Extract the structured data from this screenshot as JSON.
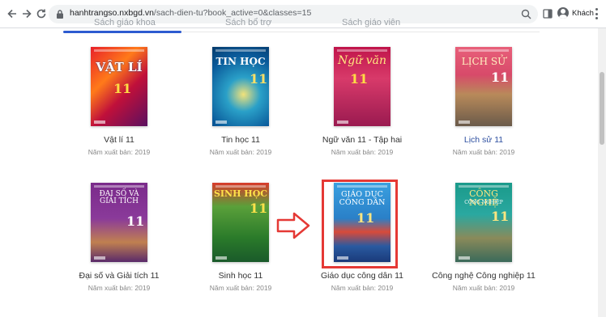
{
  "browser": {
    "url_host": "hanhtrangso.nxbgd.vn",
    "url_path": "/sach-dien-tu?book_active=0&classes=15",
    "profile_label": "Khách"
  },
  "tabs": [
    {
      "label": "Sách giáo khoa",
      "active": true
    },
    {
      "label": "Sách bổ trợ",
      "active": false
    },
    {
      "label": "Sách giáo viên",
      "active": false
    }
  ],
  "books": [
    {
      "title": "Vật lí 11",
      "meta": "Năm xuất bản: 2019",
      "cover_text": "VẬT LÍ",
      "cover_num": "11"
    },
    {
      "title": "Tin học 11",
      "meta": "Năm xuất bản: 2019",
      "cover_text": "TIN HỌC",
      "cover_num": "11"
    },
    {
      "title": "Ngữ văn 11 - Tập hai",
      "meta": "Năm xuất bản: 2019",
      "cover_text": "Ngữ văn",
      "cover_num": "11"
    },
    {
      "title": "Lịch sử 11",
      "meta": "Năm xuất bản: 2019",
      "cover_text": "LỊCH SỬ",
      "cover_num": "11"
    },
    {
      "title": "Đại số và Giải tích 11",
      "meta": "Năm xuất bản: 2019",
      "cover_text": "ĐẠI SỐ VÀ GIẢI TÍCH",
      "cover_num": "11"
    },
    {
      "title": "Sinh học 11",
      "meta": "Năm xuất bản: 2019",
      "cover_text": "SINH HỌC",
      "cover_num": "11"
    },
    {
      "title": "Giáo dục công dân 11",
      "meta": "Năm xuất bản: 2019",
      "cover_text": "GIÁO DỤC CÔNG DÂN",
      "cover_num": "11"
    },
    {
      "title": "Công nghệ Công nghiệp 11",
      "meta": "Năm xuất bản: 2019",
      "cover_text": "CÔNG NGHỆ",
      "cover_sub": "CÔNG NGHIỆP",
      "cover_num": "11"
    }
  ],
  "colors": {
    "accent": "#2d5bd0",
    "highlight": "#e53935"
  }
}
